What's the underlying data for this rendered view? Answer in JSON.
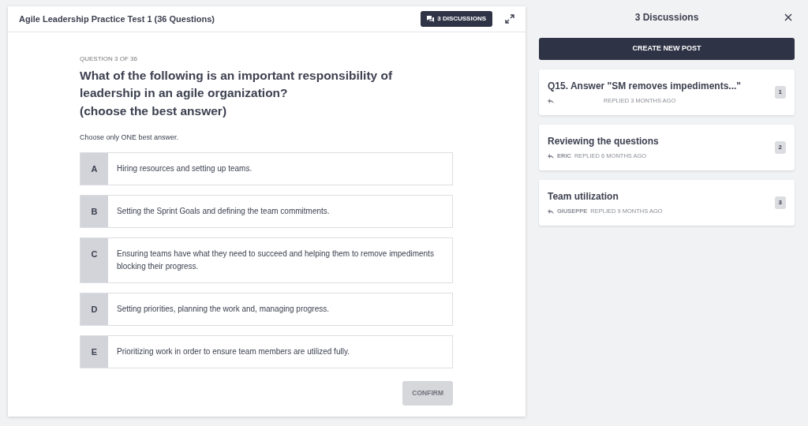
{
  "test": {
    "title": "Agile Leadership Practice Test 1 (36 Questions)",
    "discussions_button": "3 DISCUSSIONS"
  },
  "question": {
    "counter": "QUESTION 3 OF 36",
    "lines": [
      "What of the following is an important responsibility of leadership in an agile organization?",
      "(choose the best answer)"
    ],
    "instruction": "Choose only ONE best answer.",
    "options": [
      {
        "letter": "A",
        "text": "Hiring resources and setting up teams.",
        "selected": false
      },
      {
        "letter": "B",
        "text": "Setting the Sprint Goals and defining the team commitments.",
        "selected": false
      },
      {
        "letter": "C",
        "text": "Ensuring teams have what they need to succeed and helping them to remove impediments blocking their progress.",
        "selected": false
      },
      {
        "letter": "D",
        "text": "Setting priorities, planning the work and, managing progress.",
        "selected": false
      },
      {
        "letter": "E",
        "text": "Prioritizing work in order to ensure team members are utilized fully.",
        "selected": false
      }
    ],
    "confirm": {
      "label": "CONFIRM",
      "disabled": true
    }
  },
  "discussions": {
    "title": "3 Discussions",
    "create_button": "CREATE NEW POST",
    "posts": [
      {
        "title": "Q15. Answer \"SM removes impediments...\"",
        "replied": "REPLIED 3 MONTHS AGO",
        "count": "1"
      },
      {
        "title": "Reviewing the questions",
        "author": "ERIC",
        "replied": "REPLIED 6 MONTHS AGO",
        "count": "2"
      },
      {
        "title": "Team utilization",
        "author": "GIUSEPPE",
        "replied": "REPLIED 9 MONTHS AGO",
        "count": "3"
      }
    ]
  }
}
